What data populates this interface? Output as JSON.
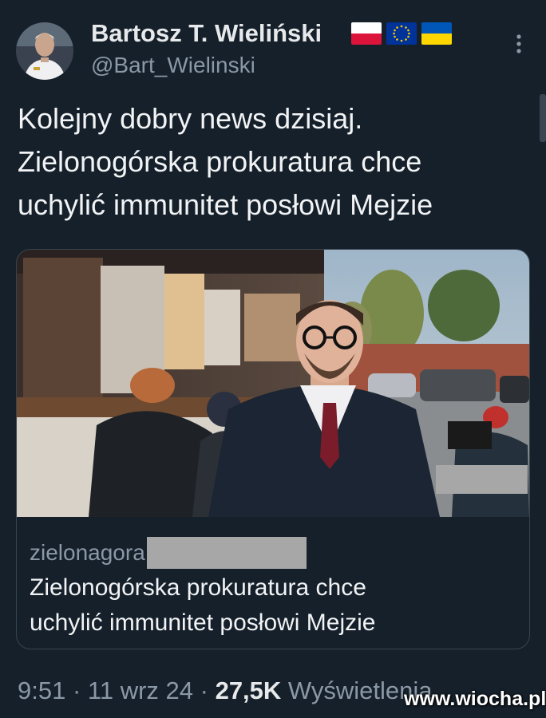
{
  "author": {
    "name": "Bartosz T. Wieliński",
    "handle": "@Bart_Wielinski",
    "avatar_icon": "profile-photo",
    "flags": [
      "poland-flag",
      "eu-flag",
      "ukraine-flag"
    ]
  },
  "tweet": {
    "lines": [
      "Kolejny dobry news dzisiaj.",
      "Zielonogórska prokuratura chce",
      "uchylić immunitet posłowi Mejzie"
    ]
  },
  "card": {
    "domain": "zielonagora",
    "title_lines": [
      "Zielonogórska prokuratura chce",
      "uchylić immunitet posłowi Mejzie"
    ],
    "image_icon": "news-photo"
  },
  "meta": {
    "time": "9:51",
    "sep1": " · ",
    "date": "11 wrz 24",
    "sep2": " · ",
    "views": "27,5K",
    "views_label": " Wyświetlenia"
  },
  "watermark": "www.wiocha.pl",
  "colors": {
    "background": "#15202b",
    "text": "#e7e9ea",
    "secondary": "#8b98a5",
    "border": "#38444d"
  }
}
